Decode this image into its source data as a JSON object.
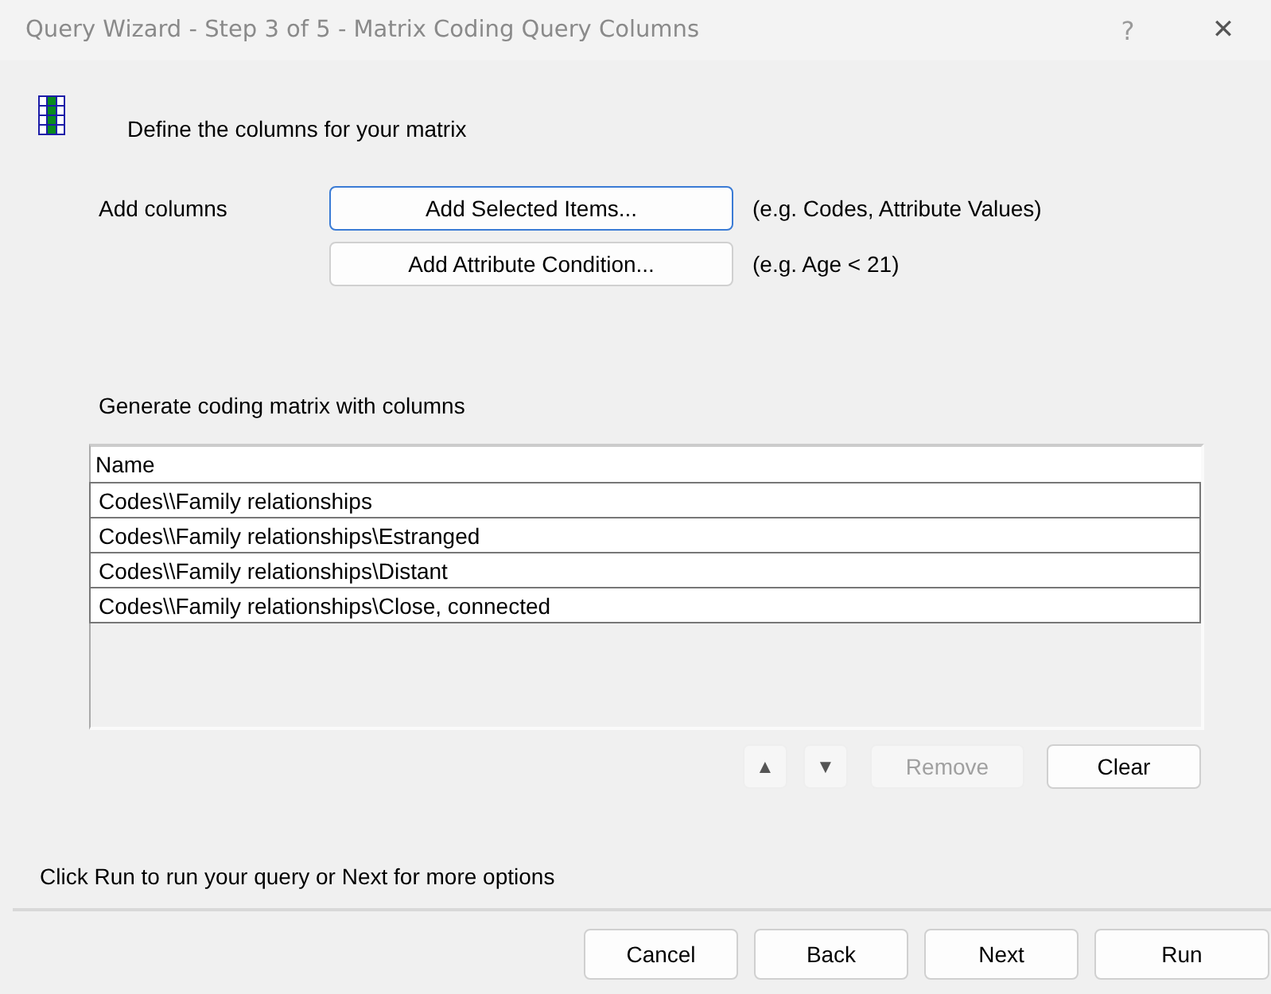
{
  "window": {
    "title": "Query Wizard - Step 3 of 5 - Matrix Coding Query Columns",
    "help": "?",
    "close": "✕"
  },
  "heading": "Define the columns for your matrix",
  "add_columns": {
    "label": "Add columns",
    "buttons": [
      {
        "label": "Add Selected Items...",
        "hint": "(e.g. Codes, Attribute Values)",
        "focused": true
      },
      {
        "label": "Add Attribute Condition...",
        "hint": "(e.g. Age < 21)",
        "focused": false
      }
    ]
  },
  "list_label": "Generate coding matrix with columns",
  "table": {
    "columns": [
      "Name"
    ],
    "rows": [
      {
        "name": "Codes\\\\Family relationships"
      },
      {
        "name": "Codes\\\\Family relationships\\Estranged"
      },
      {
        "name": "Codes\\\\Family relationships\\Distant"
      },
      {
        "name": "Codes\\\\Family relationships\\Close, connected"
      }
    ]
  },
  "list_buttons": [
    {
      "kind": "icon",
      "label": "▲",
      "disabled": true
    },
    {
      "kind": "icon",
      "label": "▼",
      "disabled": true
    },
    {
      "kind": "text",
      "label": "Remove",
      "disabled": true
    },
    {
      "kind": "text",
      "label": "Clear",
      "disabled": false
    }
  ],
  "status": "Click Run to run your query or Next for more options",
  "footer_buttons": [
    "Cancel",
    "Back",
    "Next",
    "Run"
  ]
}
